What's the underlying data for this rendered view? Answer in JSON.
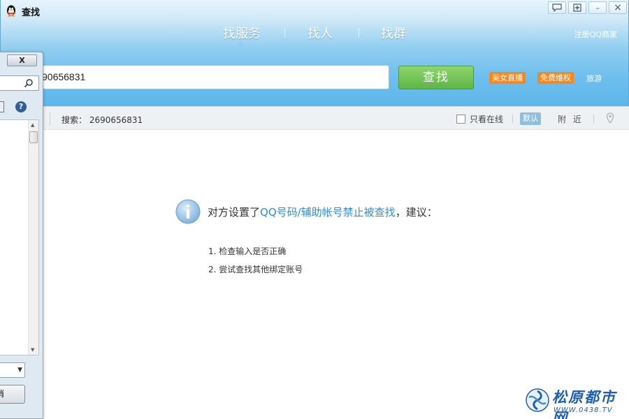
{
  "window": {
    "title": "查找",
    "controls": {
      "feedback_icon": "chat-bubble-icon",
      "pin_icon": "pin-window-icon",
      "minimize": "–",
      "close": "×"
    }
  },
  "nav": {
    "tabs": [
      {
        "label": "找服务",
        "active": true
      },
      {
        "label": "找人",
        "active": false
      },
      {
        "label": "找群",
        "active": false
      }
    ],
    "register_link": "注册QQ商家"
  },
  "search": {
    "query_visible": "90656831",
    "button_label": "查找",
    "promos": [
      "美女直播",
      "免费维权"
    ],
    "promo_link": "旅游"
  },
  "toolbar": {
    "search_prefix": "搜索：",
    "search_term": "2690656831",
    "online_only_label": "只看在线",
    "online_only_checked": false,
    "sort_default": "默认",
    "sort_nearby": "附 近"
  },
  "message": {
    "prefix": "对方设置了",
    "highlight": "QQ号码/辅助帐号禁止被查找",
    "suffix": "，建议：",
    "tips": [
      "1.  检查输入是否正确",
      "2.  尝试查找其他绑定账号"
    ]
  },
  "side_dialog": {
    "close_label": "X",
    "help_label": "?",
    "cancel_label": "消"
  },
  "watermark": {
    "text": "松原都市网",
    "url": "WWW.0438.TV"
  },
  "colors": {
    "accent_blue": "#2b8fd3",
    "find_green": "#5eb544",
    "promo_orange": "#f28a1d"
  }
}
